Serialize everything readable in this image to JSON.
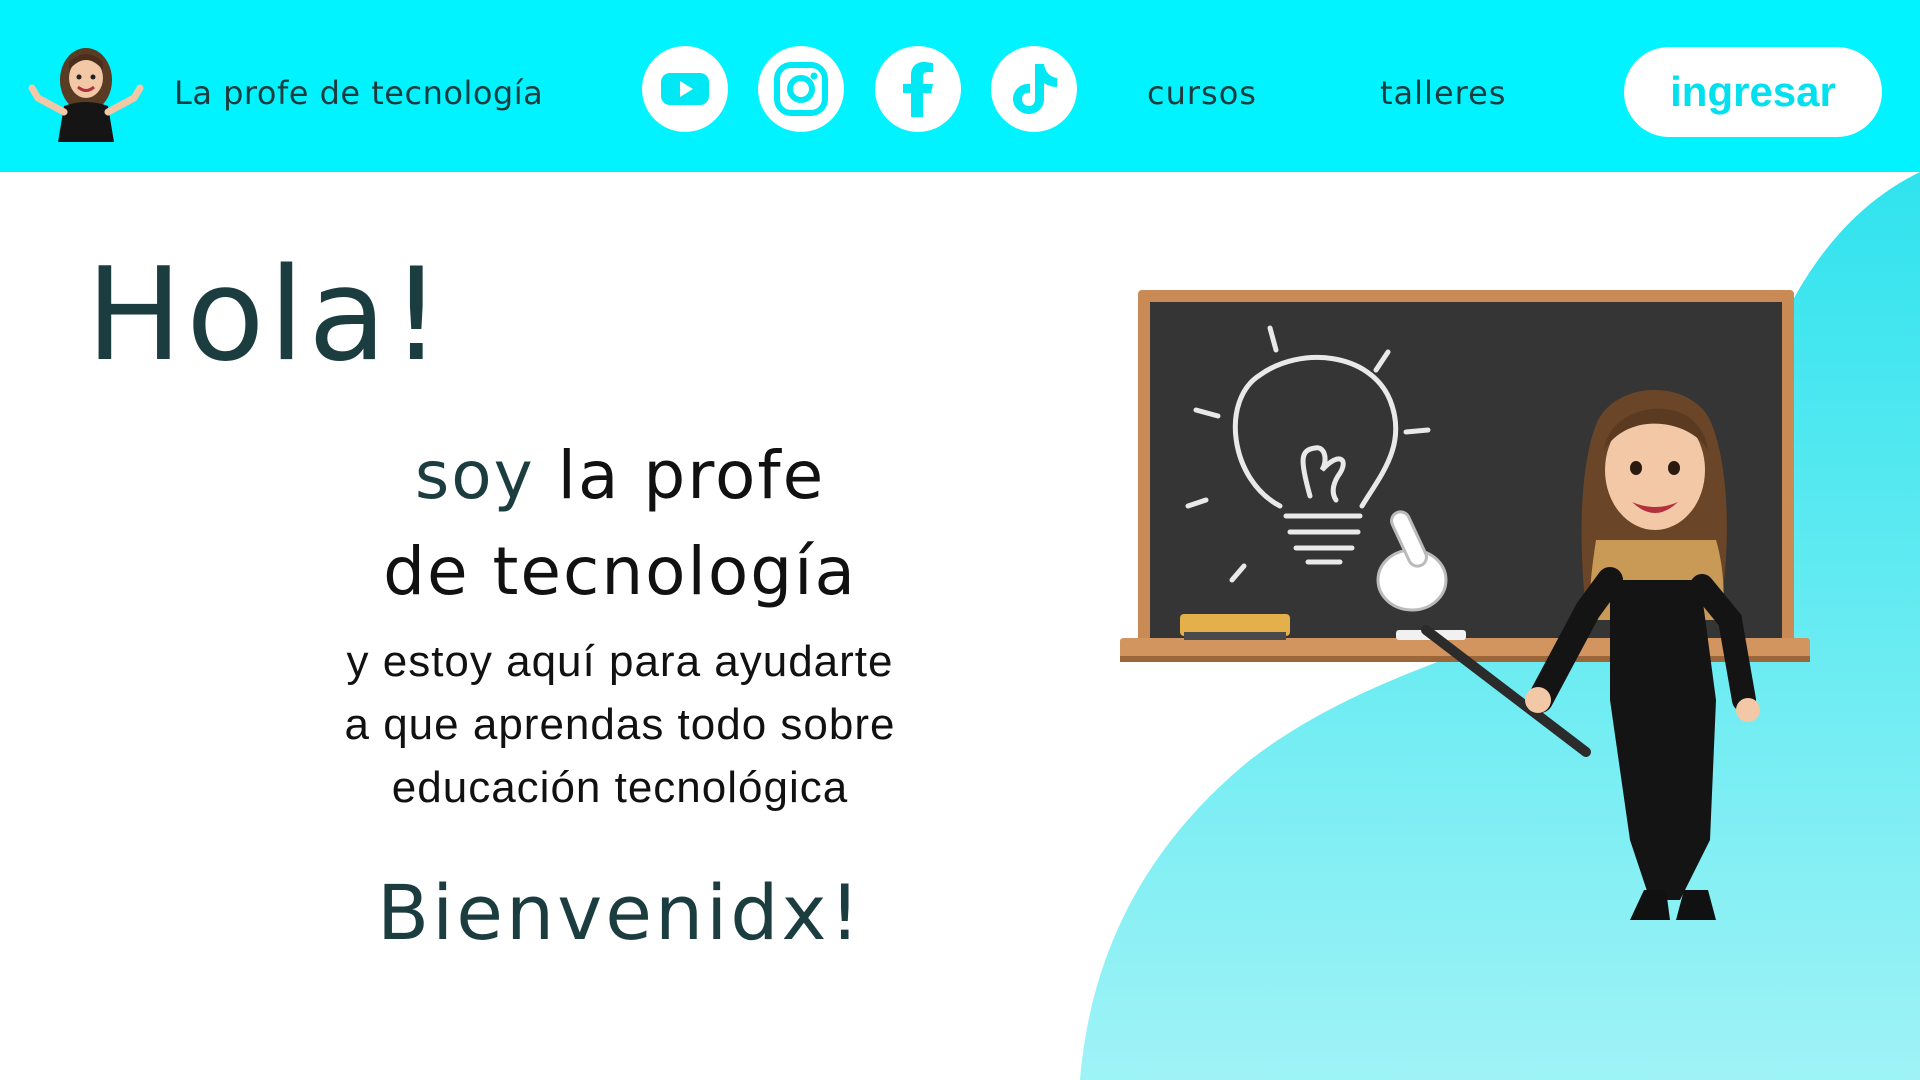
{
  "header": {
    "site_title": "La profe de tecnología",
    "social": [
      {
        "name": "youtube-icon"
      },
      {
        "name": "instagram-icon"
      },
      {
        "name": "facebook-icon"
      },
      {
        "name": "tiktok-icon"
      }
    ],
    "nav": [
      {
        "label": "cursos"
      },
      {
        "label": "talleres"
      }
    ],
    "login_label": "ingresar"
  },
  "hero": {
    "hello": "Hola!",
    "intro_soy": "soy",
    "intro_rest": "la profe",
    "intro_line2": "de tecnología",
    "desc_line1": "y estoy aquí para ayudarte",
    "desc_line2": "a que aprendas todo sobre",
    "desc_line3": "educación tecnológica",
    "welcome": "Bienvenidx!"
  },
  "colors": {
    "header_bg": "#00f3ff",
    "accent": "#00e0ee",
    "text_dark": "#1c3d40",
    "blob": "#5fe9f0"
  }
}
